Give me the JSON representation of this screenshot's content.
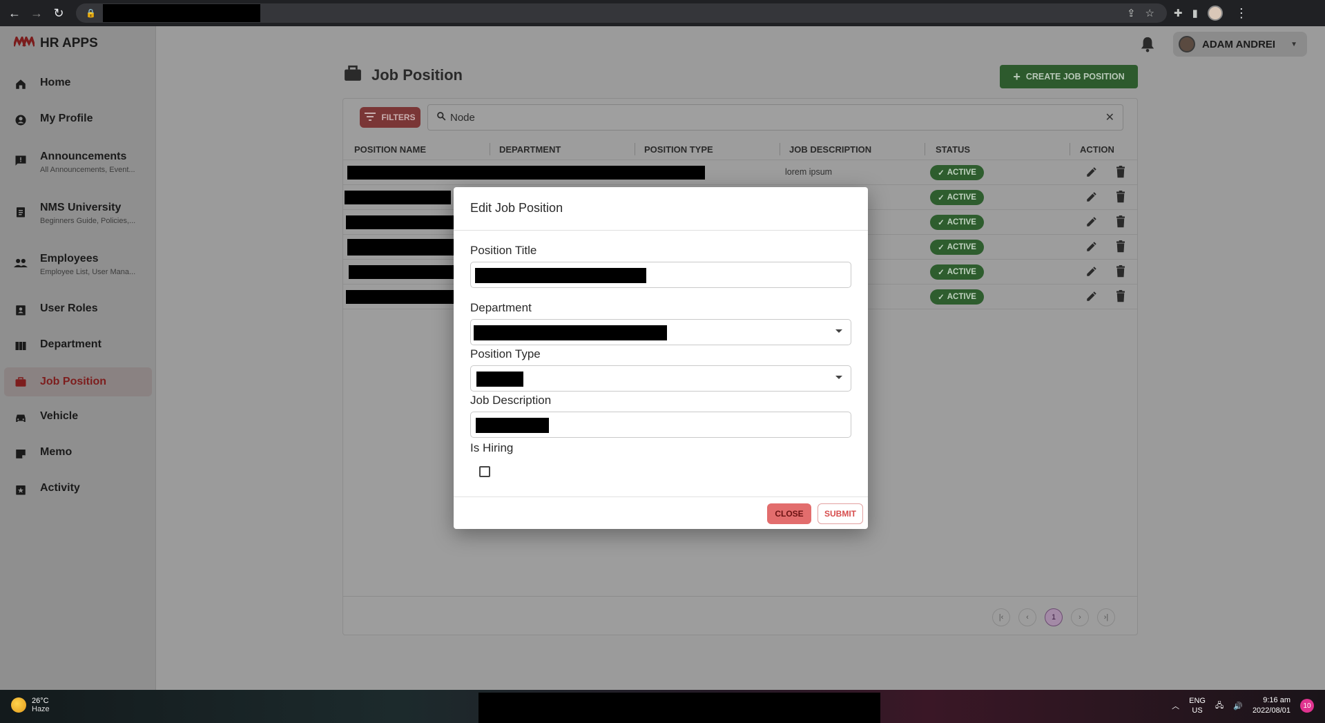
{
  "app": {
    "brand": "HR APPS"
  },
  "sidebar": {
    "items": [
      {
        "label": "Home",
        "sub": ""
      },
      {
        "label": "My Profile",
        "sub": ""
      },
      {
        "label": "Announcements",
        "sub": "All Announcements, Event..."
      },
      {
        "label": "NMS University",
        "sub": "Beginners Guide, Policies,..."
      },
      {
        "label": "Employees",
        "sub": "Employee List, User Mana..."
      },
      {
        "label": "User Roles",
        "sub": ""
      },
      {
        "label": "Department",
        "sub": ""
      },
      {
        "label": "Job Position",
        "sub": ""
      },
      {
        "label": "Vehicle",
        "sub": ""
      },
      {
        "label": "Memo",
        "sub": ""
      },
      {
        "label": "Activity",
        "sub": ""
      }
    ],
    "active": "Job Position"
  },
  "header": {
    "user_name": "ADAM ANDREI"
  },
  "page": {
    "title": "Job Position",
    "create_label": "CREATE JOB POSITION"
  },
  "toolbar": {
    "filters_label": "FILTERS",
    "search_value": "Node"
  },
  "table": {
    "columns": [
      "POSITION NAME",
      "DEPARTMENT",
      "POSITION TYPE",
      "JOB DESCRIPTION",
      "STATUS",
      "ACTION"
    ],
    "rows": [
      {
        "description": "lorem ipsum",
        "status": "ACTIVE"
      },
      {
        "description": "",
        "status": "ACTIVE"
      },
      {
        "description": "",
        "status": "ACTIVE"
      },
      {
        "description": "",
        "status": "ACTIVE"
      },
      {
        "description": "",
        "status": "ACTIVE"
      },
      {
        "description": "",
        "status": "ACTIVE"
      }
    ]
  },
  "pagination": {
    "current_page": "1"
  },
  "modal": {
    "title": "Edit Job Position",
    "fields": {
      "position_title": "Position Title",
      "department": "Department",
      "position_type": "Position Type",
      "job_description": "Job Description",
      "is_hiring": "Is Hiring"
    },
    "is_hiring_checked": false,
    "close_label": "CLOSE",
    "submit_label": "SUBMIT"
  },
  "taskbar": {
    "temperature": "26°C",
    "condition": "Haze",
    "lang_top": "ENG",
    "lang_bottom": "US",
    "time": "9:16 am",
    "date": "2022/08/01",
    "notification_count": "10"
  },
  "colors": {
    "brand_red": "#7d1d1d",
    "active_green": "#2e5d2e",
    "close_button": "#e26d6d"
  }
}
